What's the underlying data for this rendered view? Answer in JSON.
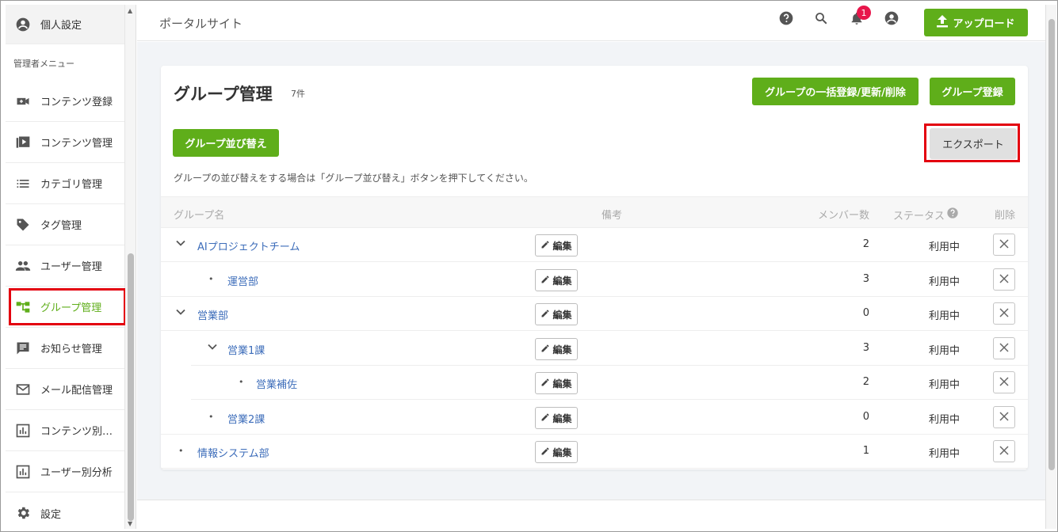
{
  "sidebar": {
    "personal": "個人設定",
    "admin_label": "管理者メニュー",
    "items": [
      {
        "label": "コンテンツ登録",
        "icon": "video-add-icon"
      },
      {
        "label": "コンテンツ管理",
        "icon": "content-library-icon"
      },
      {
        "label": "カテゴリ管理",
        "icon": "list-icon"
      },
      {
        "label": "タグ管理",
        "icon": "tag-icon"
      },
      {
        "label": "ユーザー管理",
        "icon": "people-icon"
      },
      {
        "label": "グループ管理",
        "icon": "group-tree-icon",
        "active": true
      },
      {
        "label": "お知らせ管理",
        "icon": "announcement-icon"
      },
      {
        "label": "メール配信管理",
        "icon": "mail-icon"
      },
      {
        "label": "コンテンツ別…",
        "icon": "bar-chart-icon"
      },
      {
        "label": "ユーザー別分析",
        "icon": "bar-chart-icon"
      },
      {
        "label": "設定",
        "icon": "gear-icon"
      }
    ]
  },
  "header": {
    "portal_title": "ポータルサイト",
    "notification_count": "1",
    "upload_label": "アップロード"
  },
  "page": {
    "title": "グループ管理",
    "count": "7件",
    "bulk_button": "グループの一括登録/更新/削除",
    "register_button": "グループ登録",
    "sort_button": "グループ並び替え",
    "export_button": "エクスポート",
    "hint": "グループの並び替えをする場合は「グループ並び替え」ボタンを押下してください。"
  },
  "table": {
    "headers": {
      "name": "グループ名",
      "note": "備考",
      "members": "メンバー数",
      "status": "ステータス",
      "delete": "削除"
    },
    "edit_label": "編集",
    "rows": [
      {
        "name": "AIプロジェクトチーム",
        "members": "2",
        "status": "利用中",
        "expander": "chevron",
        "level": 0
      },
      {
        "name": "運営部",
        "members": "3",
        "status": "利用中",
        "expander": "dot",
        "level": 1
      },
      {
        "name": "営業部",
        "members": "0",
        "status": "利用中",
        "expander": "chevron",
        "level": 0
      },
      {
        "name": "営業1課",
        "members": "3",
        "status": "利用中",
        "expander": "chevron",
        "level": 1
      },
      {
        "name": "営業補佐",
        "members": "2",
        "status": "利用中",
        "expander": "dot",
        "level": 2
      },
      {
        "name": "営業2課",
        "members": "0",
        "status": "利用中",
        "expander": "dot",
        "level": 1
      },
      {
        "name": "情報システム部",
        "members": "1",
        "status": "利用中",
        "expander": "dot",
        "level": 0
      }
    ]
  },
  "colors": {
    "accent_green": "#5fae1a",
    "link_blue": "#3d6dba",
    "highlight_red": "#e3000f",
    "badge_pink": "#e8164b"
  }
}
